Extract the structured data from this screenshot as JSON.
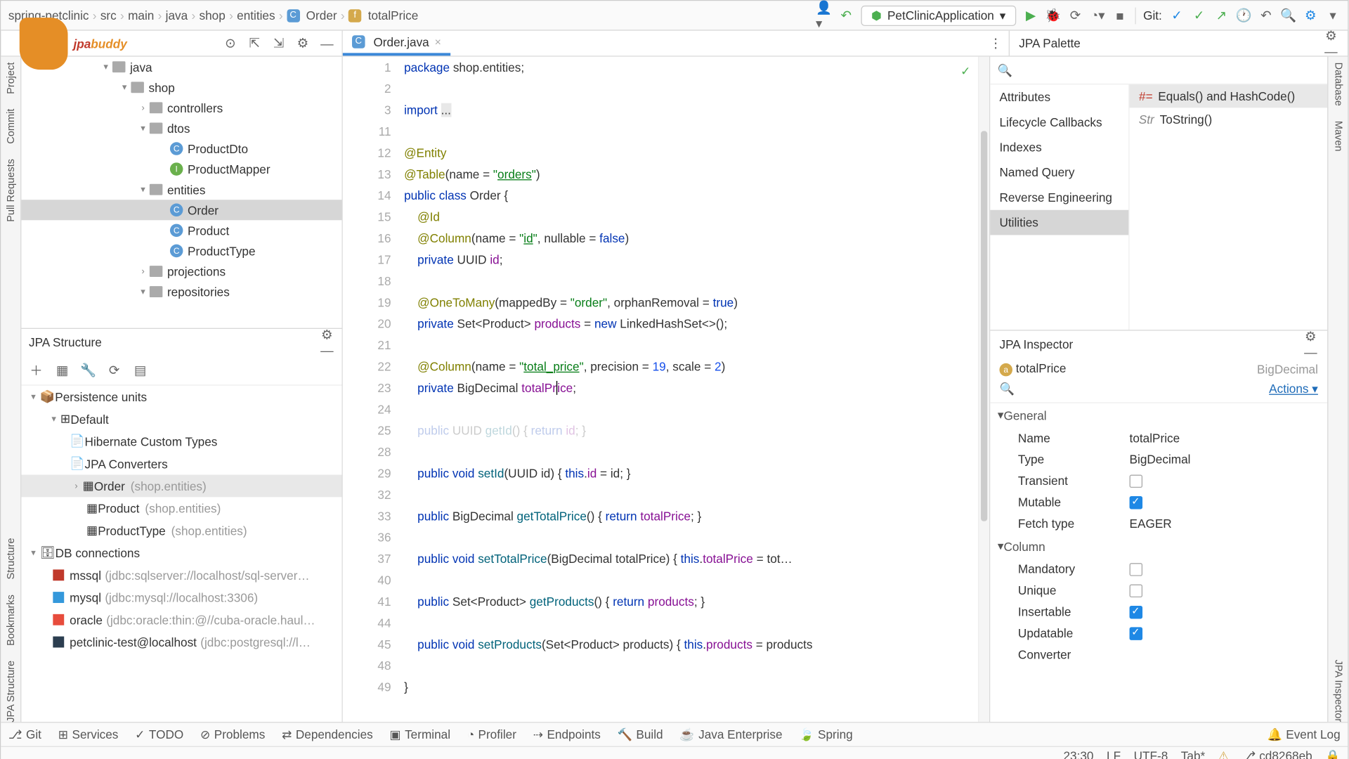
{
  "breadcrumb": [
    "spring-petclinic",
    "src",
    "main",
    "java",
    "shop",
    "entities"
  ],
  "breadcrumb_class": "Order",
  "breadcrumb_field": "totalPrice",
  "run_config": "PetClinicApplication",
  "git_label": "Git:",
  "editor_tab": "Order.java",
  "logo_a": "jpa",
  "logo_b": "buddy",
  "project": {
    "java": "java",
    "shop": "shop",
    "controllers": "controllers",
    "dtos": "dtos",
    "productDto": "ProductDto",
    "productMapper": "ProductMapper",
    "entities": "entities",
    "order": "Order",
    "product": "Product",
    "productType": "ProductType",
    "projections": "projections",
    "repositories": "repositories"
  },
  "jpa_struct": {
    "title": "JPA Structure",
    "pu": "Persistence units",
    "default": "Default",
    "hct": "Hibernate Custom Types",
    "jconv": "JPA Converters",
    "order": "Order",
    "order_pkg": "(shop.entities)",
    "product": "Product",
    "product_pkg": "(shop.entities)",
    "ptype": "ProductType",
    "ptype_pkg": "(shop.entities)",
    "dbconn": "DB connections",
    "mssql": "mssql",
    "mssql_url": "(jdbc:sqlserver://localhost/sql-server…",
    "mysql": "mysql",
    "mysql_url": "(jdbc:mysql://localhost:3306)",
    "oracle": "oracle",
    "oracle_url": "(jdbc:oracle:thin:@//cuba-oracle.haul…",
    "pg": "petclinic-test@localhost",
    "pg_url": "(jdbc:postgresql://l…"
  },
  "palette": {
    "title": "JPA Palette",
    "cats": [
      "Attributes",
      "Lifecycle Callbacks",
      "Indexes",
      "Named Query",
      "Reverse Engineering",
      "Utilities"
    ],
    "it1": "Equals() and HashCode()",
    "it2": "ToString()"
  },
  "inspector": {
    "title": "JPA Inspector",
    "attr": "totalPrice",
    "attr_type": "BigDecimal",
    "actions": "Actions",
    "general": "General",
    "name_l": "Name",
    "name_v": "totalPrice",
    "type_l": "Type",
    "type_v": "BigDecimal",
    "transient_l": "Transient",
    "mutable_l": "Mutable",
    "fetch_l": "Fetch type",
    "fetch_v": "EAGER",
    "column": "Column",
    "mandatory_l": "Mandatory",
    "unique_l": "Unique",
    "insertable_l": "Insertable",
    "updatable_l": "Updatable",
    "converter_l": "Converter"
  },
  "left_rail": [
    "JPA Structure",
    "Bookmarks",
    "Structure",
    "Pull Requests",
    "Commit",
    "Project"
  ],
  "right_rail": [
    "Database",
    "Maven",
    "JPA Inspector"
  ],
  "bottom": [
    "Git",
    "Services",
    "TODO",
    "Problems",
    "Dependencies",
    "Terminal",
    "Profiler",
    "Endpoints",
    "Build",
    "Java Enterprise",
    "Spring"
  ],
  "event_log": "Event Log",
  "status": {
    "pos": "23:30",
    "lf": "LF",
    "enc": "UTF-8",
    "tab": "Tab*",
    "branch": "cd8268eb"
  },
  "lines": [
    "1",
    "2",
    "3",
    "11",
    "12",
    "13",
    "14",
    "15",
    "16",
    "17",
    "18",
    "19",
    "20",
    "21",
    "22",
    "23",
    "24",
    "25",
    "28",
    "29",
    "32",
    "33",
    "36",
    "37",
    "40",
    "41",
    "44",
    "45",
    "48",
    "49"
  ]
}
